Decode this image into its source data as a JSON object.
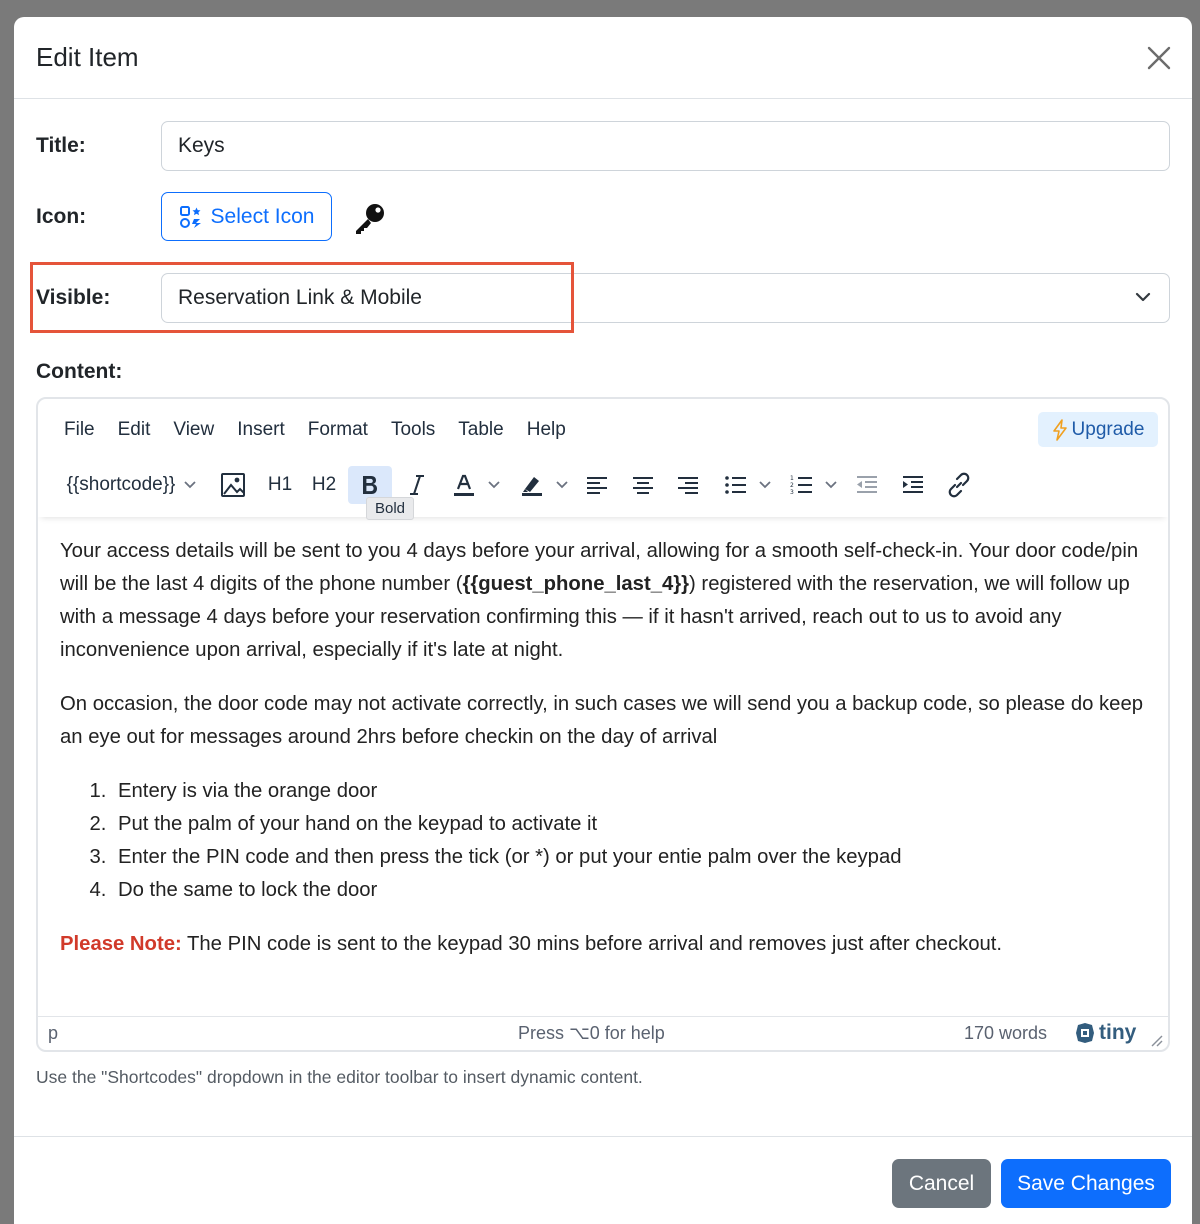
{
  "modal": {
    "title": "Edit Item"
  },
  "form": {
    "title_label": "Title:",
    "title_value": "Keys",
    "icon_label": "Icon:",
    "select_icon_label": "Select Icon",
    "selected_icon": "key-icon",
    "visible_label": "Visible:",
    "visible_value": "Reservation Link & Mobile",
    "content_label": "Content:"
  },
  "editor": {
    "menu": [
      "File",
      "Edit",
      "View",
      "Insert",
      "Format",
      "Tools",
      "Table",
      "Help"
    ],
    "upgrade_label": "Upgrade",
    "toolbar": {
      "shortcode_label": "{{shortcode}}",
      "h1": "H1",
      "h2": "H2",
      "bold_tooltip": "Bold"
    },
    "content": {
      "para1_a": "Your access details will be sent to you 4 days before your arrival, allowing for a smooth self-check-in. Your door code/pin will be the last 4 digits of the phone number (",
      "para1_shortcode": "{{guest_phone_last_4}}",
      "para1_b": ") registered with the reservation, we will follow up with a message 4 days before your reservation confirming this — if it hasn't arrived, reach out to us to avoid any inconvenience upon arrival, especially if it's late at night.",
      "para2": "On occasion, the door code may not activate correctly, in such cases we will send you a backup code, so please do keep an eye out for messages around 2hrs before checkin on the day of arrival",
      "steps": [
        "Entery is via the orange door",
        "Put the palm of your hand on the keypad to activate it",
        "Enter the PIN code and then press the tick (or *) or put your entie palm over the keypad",
        "Do the same to lock the door"
      ],
      "note_label": "Please Note:",
      "note_text": " The PIN code is sent to the keypad 30 mins before arrival and removes just after checkout."
    },
    "statusbar": {
      "path": "p",
      "help": "Press ⌥0 for help",
      "word_count": "170 words",
      "brand": "tiny"
    }
  },
  "help_text": "Use the \"Shortcodes\" dropdown in the editor toolbar to insert dynamic content.",
  "footer": {
    "cancel_label": "Cancel",
    "save_label": "Save Changes"
  },
  "colors": {
    "primary": "#0d6efd",
    "secondary": "#6c757d",
    "highlight": "#e5543a",
    "note": "#d13a2a"
  }
}
